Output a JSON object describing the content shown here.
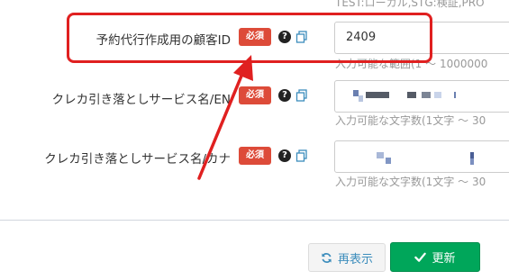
{
  "top_hint": "TEST:ローカル,STG:検証,PRO",
  "required_badge": "必須",
  "help_glyph": "?",
  "fields": [
    {
      "label": "予約代行作成用の顧客ID",
      "value": "2409",
      "hint": "入力可能な範囲(1 ～ 1000000"
    },
    {
      "label": "クレカ引き落としサービス名/EN",
      "value": "",
      "hint": "入力可能な文字数(1文字 ～ 30"
    },
    {
      "label": "クレカ引き落としサービス名/カナ",
      "value": "",
      "hint": "入力可能な文字数(1文字 ～ 30"
    }
  ],
  "buttons": {
    "refresh": "再表示",
    "update": "更新"
  },
  "annotation": {
    "color": "#e02020"
  },
  "colors": {
    "required": "#dd4b39",
    "update": "#00a65a",
    "refresh_text": "#3c8dbc"
  }
}
